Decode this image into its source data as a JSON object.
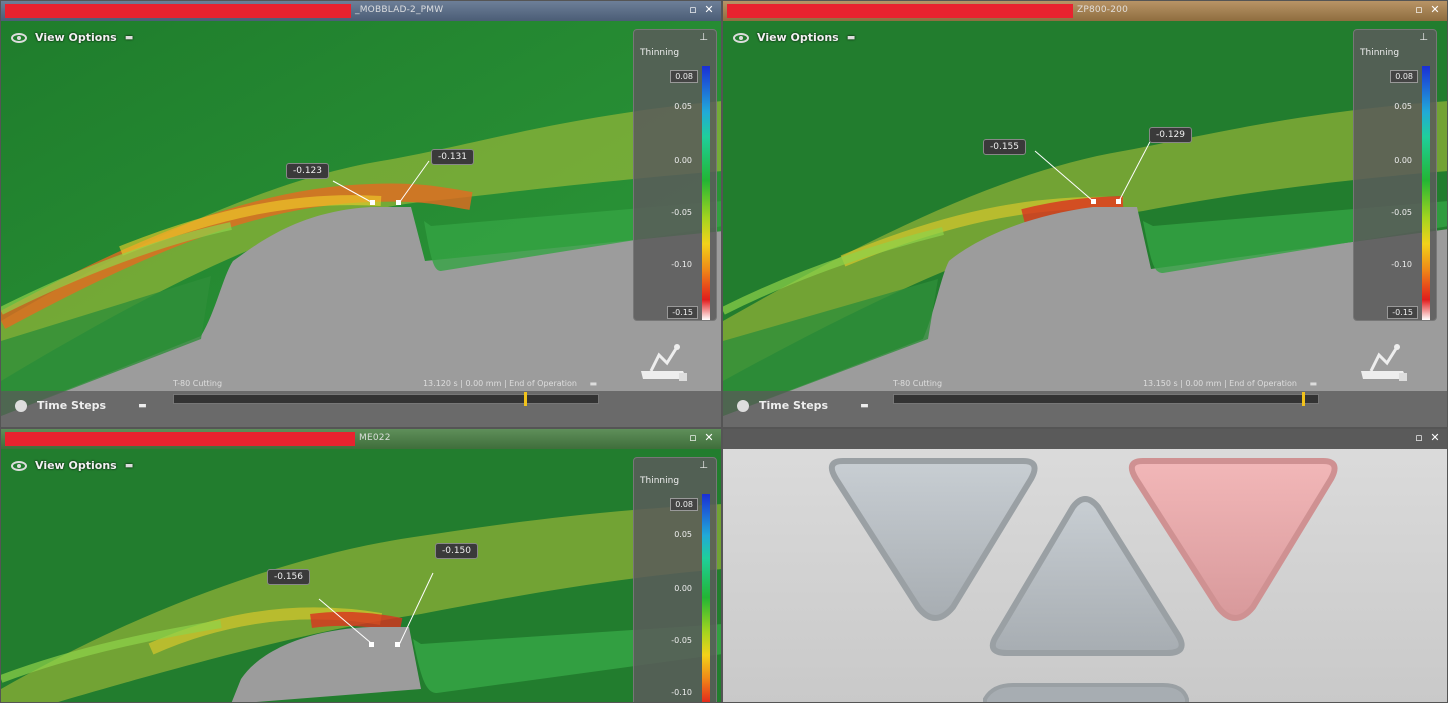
{
  "panes": [
    {
      "title": "_MOBBLAD-2_PMW",
      "view_options": "View Options",
      "legend": {
        "title": "Thinning",
        "ticks": [
          "0.08",
          "0.05",
          "0.00",
          "-0.05",
          "-0.10",
          "-0.15"
        ]
      },
      "callouts": [
        "-0.123",
        "-0.131"
      ],
      "time_steps": "Time Steps",
      "timeline": {
        "left_label": "T-80 Cutting",
        "right_label": "13.120 s | 0.00 mm | End of Operation",
        "progress": 0.85
      }
    },
    {
      "title": "ZP800-200",
      "view_options": "View Options",
      "legend": {
        "title": "Thinning",
        "ticks": [
          "0.08",
          "0.05",
          "0.00",
          "-0.05",
          "-0.10",
          "-0.15"
        ]
      },
      "callouts": [
        "-0.155",
        "-0.129"
      ],
      "time_steps": "Time Steps",
      "timeline": {
        "left_label": "T-80 Cutting",
        "right_label": "13.150 s | 0.00 mm | End of Operation",
        "progress": 0.96
      }
    },
    {
      "title": "ME022",
      "view_options": "View Options",
      "legend": {
        "title": "Thinning",
        "ticks": [
          "0.08",
          "0.05",
          "0.00",
          "-0.05",
          "-0.10"
        ]
      },
      "callouts": [
        "-0.156",
        "-0.150"
      ]
    }
  ],
  "progress_fraction": [
    0.48,
    0.47,
    0.48
  ],
  "colors": {
    "progress_red": "#e8222f",
    "title_tint": [
      "#5a6f8c",
      "#a6834f",
      "#4f7a4b"
    ],
    "pink_triangle": "#e7a9aa",
    "grey_triangle": "#b9bfc4"
  }
}
